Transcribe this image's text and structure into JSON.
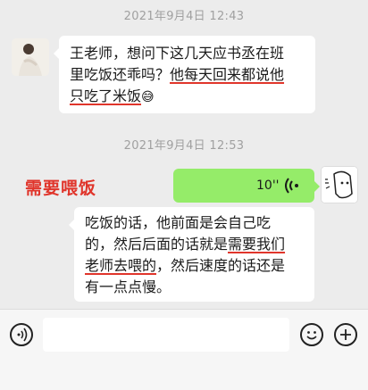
{
  "messages": {
    "ts1": "2021年9月4日 12:43",
    "msg1_line1": "王老师，想问下这几天应书丞在班",
    "msg1_line2_a": "里吃饭还乖吗？",
    "msg1_line2_b": "他每天回来都说他",
    "msg1_line3": "只吃了米饭",
    "ts2": "2021年9月4日 12:53",
    "voice_duration": "10''",
    "annotation": "需要喂饭",
    "msg3_line1": "吃饭的话，他前面是会自己吃",
    "msg3_line2_a": "的，然后后面的话就是",
    "msg3_line2_b": "需要我们",
    "msg3_line3_a": "老师去喂的",
    "msg3_line3_b": "，然后速度的话还是",
    "msg3_line4": "有一点点慢。"
  },
  "icons": {
    "emoji": "😅"
  },
  "colors": {
    "background": "#ececec",
    "green_bubble": "#95ec69",
    "annotation_red": "#e0352b",
    "timestamp": "#a0a0a0"
  }
}
